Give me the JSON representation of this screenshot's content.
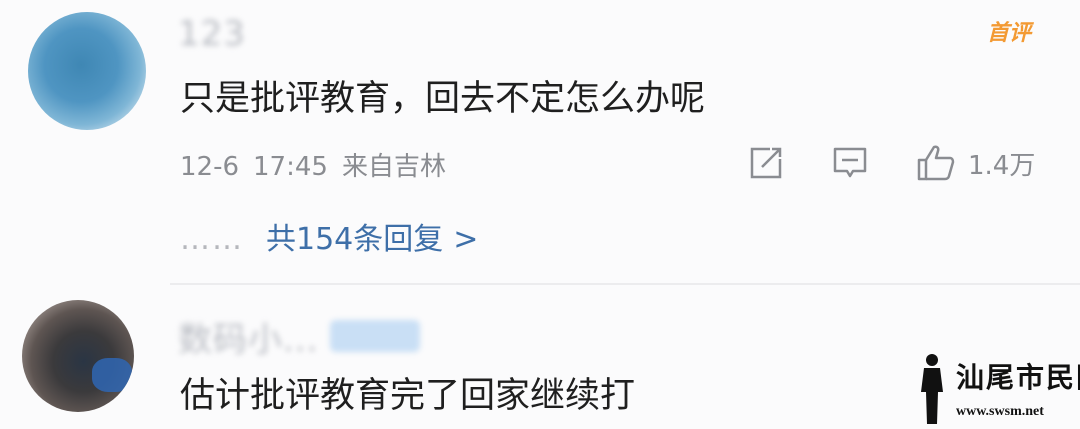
{
  "comments": [
    {
      "username": "123",
      "text": "只是批评教育，回去不定怎么办呢",
      "badge": "首评",
      "date": "12-6",
      "time": "17:45",
      "location": "来自吉林",
      "likes": "1.4万",
      "replies": {
        "dots": "……",
        "label": "共154条回复",
        "arrow": ">"
      }
    },
    {
      "username": "数码小...",
      "text": "估计批评教育完了回家继续打"
    }
  ],
  "watermark": {
    "text": "汕尾市民网",
    "url": "www.swsm.net"
  },
  "icons": {
    "share": "share-icon",
    "comment": "comment-icon",
    "like": "thumbs-up-icon",
    "watermark_figure": "person-silhouette-icon"
  },
  "colors": {
    "badge": "#f39a33",
    "reply_link": "#3e6fa8",
    "meta_text": "#8a8c91"
  }
}
